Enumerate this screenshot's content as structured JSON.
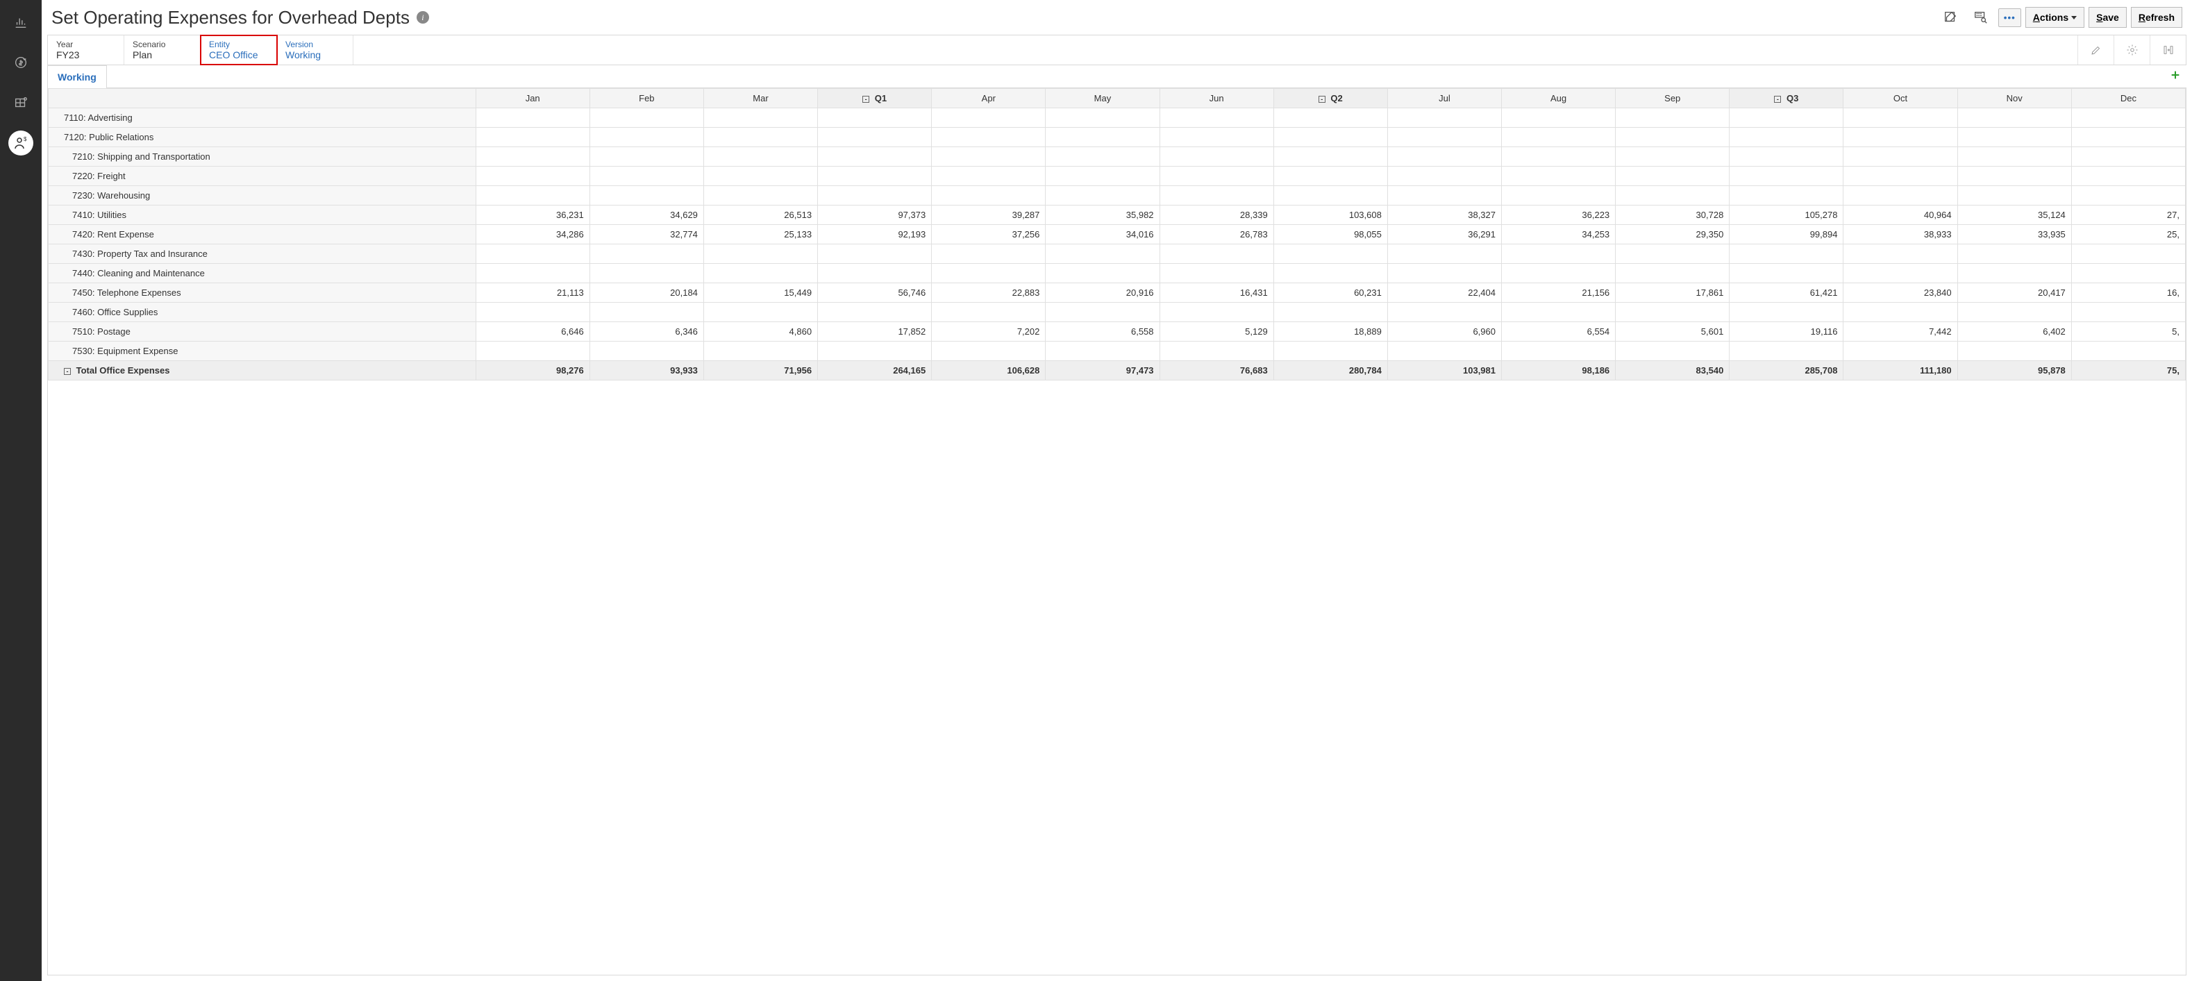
{
  "nav": {
    "items": [
      {
        "name": "chart-icon"
      },
      {
        "name": "refresh-dollar-icon"
      },
      {
        "name": "grid-cube-icon"
      },
      {
        "name": "person-dollar-icon"
      }
    ],
    "active_index": 3
  },
  "header": {
    "title": "Set Operating Expenses for Overhead Depts",
    "actions_label": "Actions",
    "save_label": "Save",
    "refresh_label": "Refresh"
  },
  "pov": {
    "cells": [
      {
        "label": "Year",
        "value": "FY23",
        "link": false,
        "highlighted": false
      },
      {
        "label": "Scenario",
        "value": "Plan",
        "link": false,
        "highlighted": false
      },
      {
        "label": "Entity",
        "value": "CEO Office",
        "link": true,
        "highlighted": true
      },
      {
        "label": "Version",
        "value": "Working",
        "link": true,
        "highlighted": false
      }
    ]
  },
  "subtabs": {
    "active": "Working"
  },
  "grid": {
    "columns": [
      {
        "label": "Jan",
        "qtr": false
      },
      {
        "label": "Feb",
        "qtr": false
      },
      {
        "label": "Mar",
        "qtr": false
      },
      {
        "label": "Q1",
        "qtr": true
      },
      {
        "label": "Apr",
        "qtr": false
      },
      {
        "label": "May",
        "qtr": false
      },
      {
        "label": "Jun",
        "qtr": false
      },
      {
        "label": "Q2",
        "qtr": true
      },
      {
        "label": "Jul",
        "qtr": false
      },
      {
        "label": "Aug",
        "qtr": false
      },
      {
        "label": "Sep",
        "qtr": false
      },
      {
        "label": "Q3",
        "qtr": true
      },
      {
        "label": "Oct",
        "qtr": false
      },
      {
        "label": "Nov",
        "qtr": false
      },
      {
        "label": "Dec",
        "qtr": false
      }
    ],
    "rows": [
      {
        "label": "7110: Advertising",
        "indent": 1,
        "total": false,
        "values": [
          "",
          "",
          "",
          "",
          "",
          "",
          "",
          "",
          "",
          "",
          "",
          "",
          "",
          "",
          ""
        ]
      },
      {
        "label": "7120: Public Relations",
        "indent": 1,
        "total": false,
        "values": [
          "",
          "",
          "",
          "",
          "",
          "",
          "",
          "",
          "",
          "",
          "",
          "",
          "",
          "",
          ""
        ]
      },
      {
        "label": "7210: Shipping and Transportation",
        "indent": 2,
        "total": false,
        "values": [
          "",
          "",
          "",
          "",
          "",
          "",
          "",
          "",
          "",
          "",
          "",
          "",
          "",
          "",
          ""
        ]
      },
      {
        "label": "7220: Freight",
        "indent": 2,
        "total": false,
        "values": [
          "",
          "",
          "",
          "",
          "",
          "",
          "",
          "",
          "",
          "",
          "",
          "",
          "",
          "",
          ""
        ]
      },
      {
        "label": "7230: Warehousing",
        "indent": 2,
        "total": false,
        "values": [
          "",
          "",
          "",
          "",
          "",
          "",
          "",
          "",
          "",
          "",
          "",
          "",
          "",
          "",
          ""
        ]
      },
      {
        "label": "7410: Utilities",
        "indent": 2,
        "total": false,
        "values": [
          "36,231",
          "34,629",
          "26,513",
          "97,373",
          "39,287",
          "35,982",
          "28,339",
          "103,608",
          "38,327",
          "36,223",
          "30,728",
          "105,278",
          "40,964",
          "35,124",
          "27,"
        ]
      },
      {
        "label": "7420: Rent Expense",
        "indent": 2,
        "total": false,
        "values": [
          "34,286",
          "32,774",
          "25,133",
          "92,193",
          "37,256",
          "34,016",
          "26,783",
          "98,055",
          "36,291",
          "34,253",
          "29,350",
          "99,894",
          "38,933",
          "33,935",
          "25,"
        ]
      },
      {
        "label": "7430: Property Tax and Insurance",
        "indent": 2,
        "total": false,
        "values": [
          "",
          "",
          "",
          "",
          "",
          "",
          "",
          "",
          "",
          "",
          "",
          "",
          "",
          "",
          ""
        ]
      },
      {
        "label": "7440: Cleaning and Maintenance",
        "indent": 2,
        "total": false,
        "values": [
          "",
          "",
          "",
          "",
          "",
          "",
          "",
          "",
          "",
          "",
          "",
          "",
          "",
          "",
          ""
        ]
      },
      {
        "label": "7450: Telephone Expenses",
        "indent": 2,
        "total": false,
        "values": [
          "21,113",
          "20,184",
          "15,449",
          "56,746",
          "22,883",
          "20,916",
          "16,431",
          "60,231",
          "22,404",
          "21,156",
          "17,861",
          "61,421",
          "23,840",
          "20,417",
          "16,"
        ]
      },
      {
        "label": "7460: Office Supplies",
        "indent": 2,
        "total": false,
        "values": [
          "",
          "",
          "",
          "",
          "",
          "",
          "",
          "",
          "",
          "",
          "",
          "",
          "",
          "",
          ""
        ]
      },
      {
        "label": "7510: Postage",
        "indent": 2,
        "total": false,
        "values": [
          "6,646",
          "6,346",
          "4,860",
          "17,852",
          "7,202",
          "6,558",
          "5,129",
          "18,889",
          "6,960",
          "6,554",
          "5,601",
          "19,116",
          "7,442",
          "6,402",
          "5,"
        ]
      },
      {
        "label": "7530: Equipment Expense",
        "indent": 2,
        "total": false,
        "values": [
          "",
          "",
          "",
          "",
          "",
          "",
          "",
          "",
          "",
          "",
          "",
          "",
          "",
          "",
          ""
        ]
      },
      {
        "label": "Total Office Expenses",
        "indent": 1,
        "total": true,
        "values": [
          "98,276",
          "93,933",
          "71,956",
          "264,165",
          "106,628",
          "97,473",
          "76,683",
          "280,784",
          "103,981",
          "98,186",
          "83,540",
          "285,708",
          "111,180",
          "95,878",
          "75,"
        ]
      }
    ]
  }
}
